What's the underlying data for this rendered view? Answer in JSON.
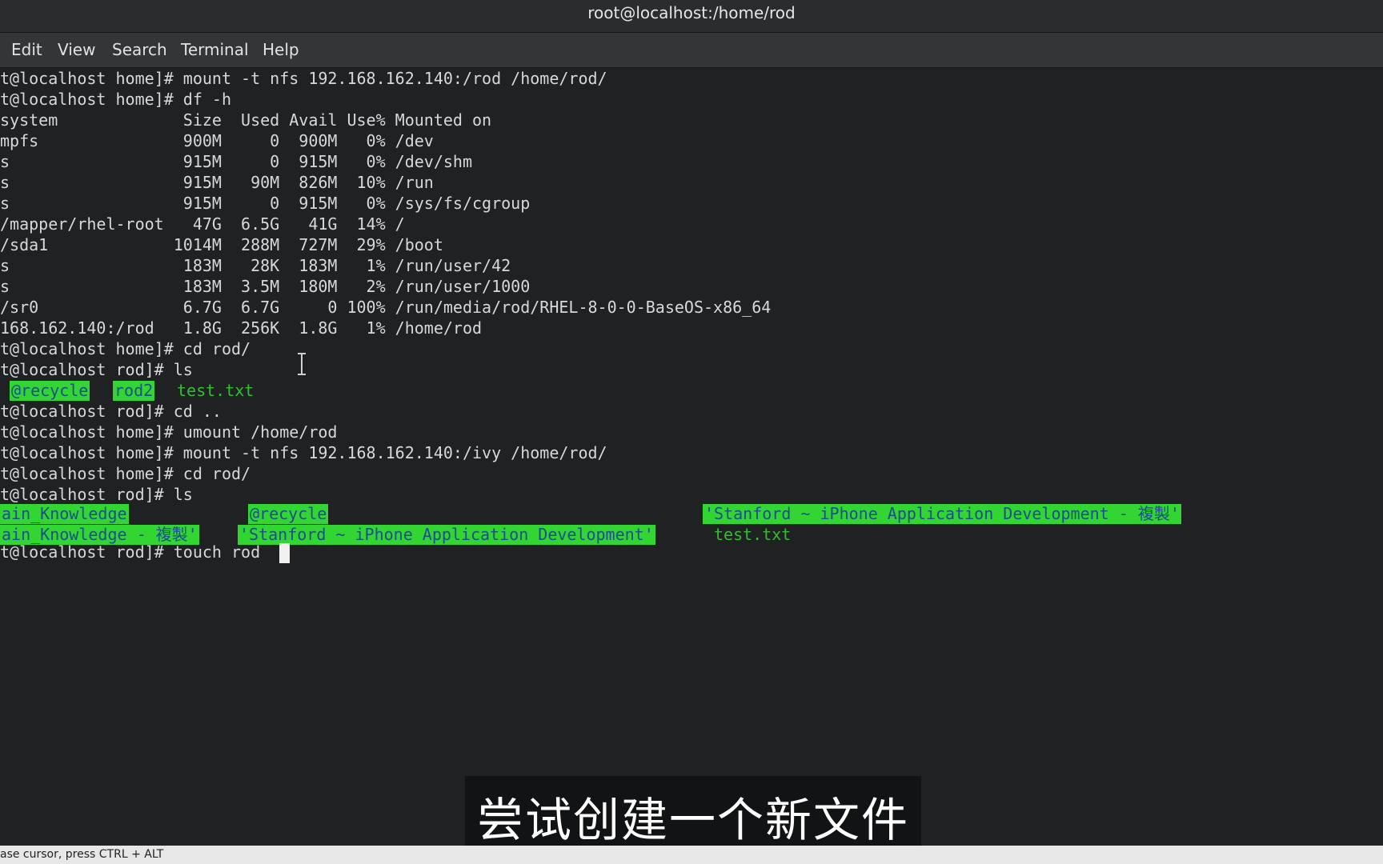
{
  "window": {
    "title": "root@localhost:/home/rod"
  },
  "menu": {
    "edit": "Edit",
    "view": "View",
    "search": "Search",
    "terminal": "Terminal",
    "help": "Help"
  },
  "terminal": {
    "lines": [
      "t@localhost home]# mount -t nfs 192.168.162.140:/rod /home/rod/",
      "t@localhost home]# df -h",
      "system             Size  Used Avail Use% Mounted on",
      "mpfs               900M     0  900M   0% /dev",
      "s                  915M     0  915M   0% /dev/shm",
      "s                  915M   90M  826M  10% /run",
      "s                  915M     0  915M   0% /sys/fs/cgroup",
      "/mapper/rhel-root   47G  6.5G   41G  14% /",
      "/sda1             1014M  288M  727M  29% /boot",
      "s                  183M   28K  183M   1% /run/user/42",
      "s                  183M  3.5M  180M   2% /run/user/1000",
      "/sr0               6.7G  6.7G     0 100% /run/media/rod/RHEL-8-0-0-BaseOS-x86_64",
      "168.162.140:/rod   1.8G  256K  1.8G   1% /home/rod",
      "t@localhost home]# cd rod/",
      "t@localhost rod]# ls",
      "",
      "t@localhost rod]# cd ..",
      "t@localhost home]# umount /home/rod",
      "t@localhost home]# mount -t nfs 192.168.162.140:/ivy /home/rod/",
      "t@localhost home]# cd rod/",
      "t@localhost rod]# ls",
      "",
      "",
      "t@localhost rod]# touch rod"
    ],
    "ls1": {
      "recycle": "@recycle",
      "rod2": "rod2",
      "test": "test.txt"
    },
    "ls2": {
      "knowledge": "ain_Knowledge",
      "recycle": "@recycle",
      "stanford_copy": "'Stanford ~ iPhone Application Development - 複製'",
      "knowledge_copy": "ain_Knowledge - 複製'",
      "stanford": "'Stanford ~ iPhone Application Development'",
      "test": "test.txt"
    }
  },
  "subtitle": "尝试创建一个新文件",
  "status": "ase cursor, press CTRL + ALT",
  "colors": {
    "terminal_bg": "#1f2123",
    "highlight_bg": "#32d531",
    "highlight_fg": "#1b4f8c",
    "green_text": "#2fc02a"
  }
}
